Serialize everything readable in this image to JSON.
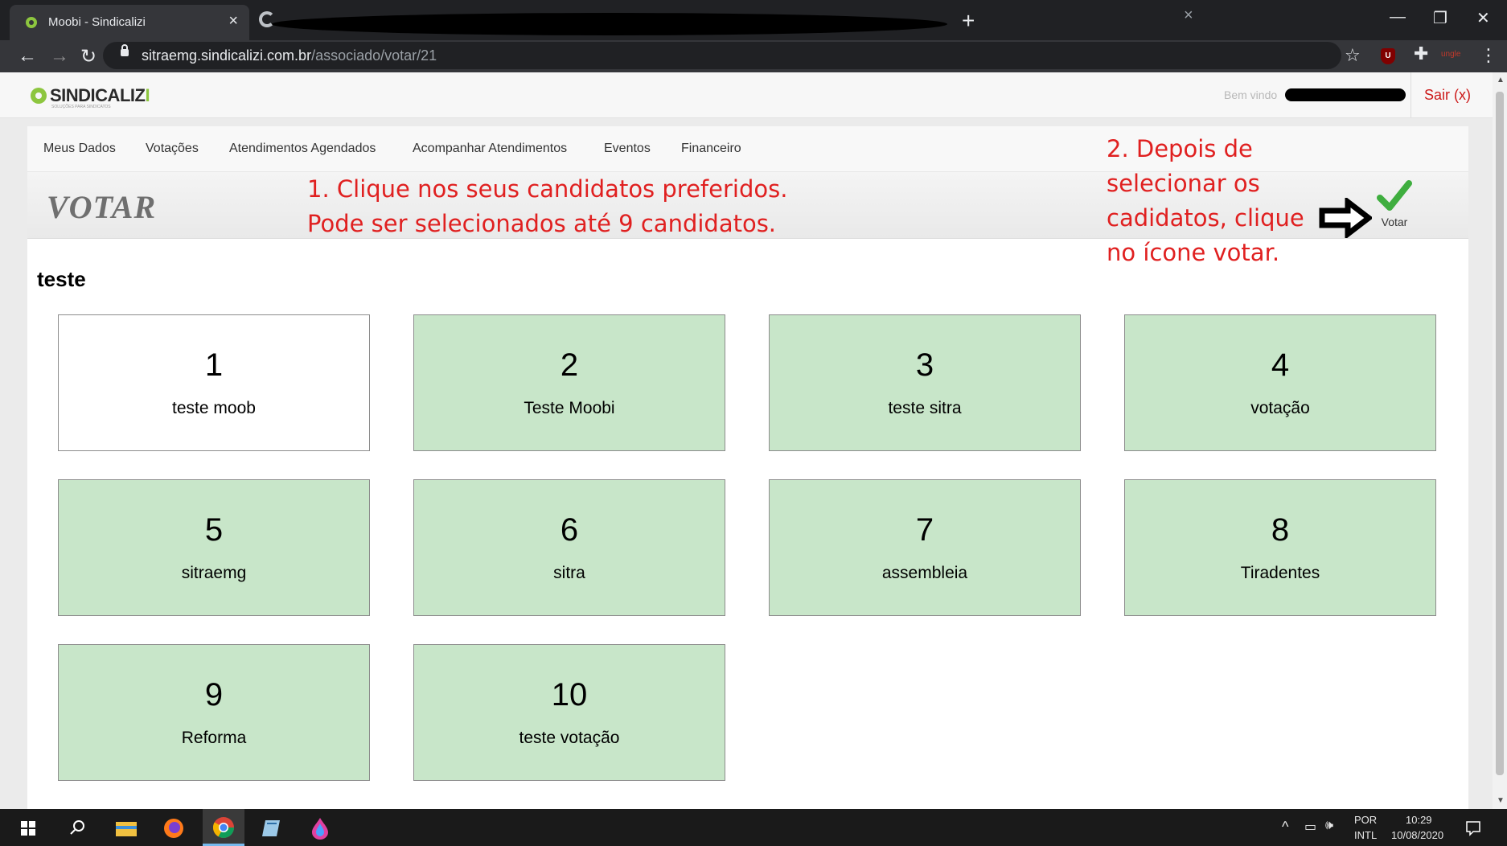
{
  "browser": {
    "tab_title": "Moobi - Sindicalizi",
    "tab_close": "×",
    "new_tab": "+",
    "url_host": "sitraemg.sindicalizi.com.br",
    "url_path": "/associado/votar/21",
    "ext_label": "ungle"
  },
  "site": {
    "logo_main": "SINDICALIZ",
    "logo_i": "I",
    "logo_sub": "SOLUÇÕES PARA SINDICATOS",
    "welcome": "Bem vindo",
    "logout": "Sair (x)"
  },
  "menu": {
    "items": [
      "Meus Dados",
      "Votações",
      "Atendimentos Agendados",
      "Acompanhar Atendimentos",
      "Eventos",
      "Financeiro"
    ]
  },
  "page": {
    "title": "VOTAR",
    "vote_button": "Votar",
    "section": "teste"
  },
  "annotations": {
    "step1_line1": "1. Clique nos seus candidatos preferidos.",
    "step1_line2": "Pode ser selecionados até 9 candidatos.",
    "step2_line1": "2. Depois de",
    "step2_line2": "selecionar os",
    "step2_line3": "cadidatos, clique",
    "step2_line4": "no ícone votar."
  },
  "candidates": [
    {
      "number": "1",
      "name": "teste moob",
      "selected": false
    },
    {
      "number": "2",
      "name": "Teste Moobi",
      "selected": true
    },
    {
      "number": "3",
      "name": "teste sitra",
      "selected": true
    },
    {
      "number": "4",
      "name": "votação",
      "selected": true
    },
    {
      "number": "5",
      "name": "sitraemg",
      "selected": true
    },
    {
      "number": "6",
      "name": "sitra",
      "selected": true
    },
    {
      "number": "7",
      "name": "assembleia",
      "selected": true
    },
    {
      "number": "8",
      "name": "Tiradentes",
      "selected": true
    },
    {
      "number": "9",
      "name": "Reforma",
      "selected": true
    },
    {
      "number": "10",
      "name": "teste votação",
      "selected": true
    }
  ],
  "colors": {
    "selected_card": "#c8e6c9",
    "annotation": "#e02020",
    "logo_green": "#8dc63f",
    "logout": "#cc1a1a"
  },
  "taskbar": {
    "lang_top": "POR",
    "lang_bottom": "INTL",
    "time": "10:29",
    "date": "10/08/2020"
  }
}
